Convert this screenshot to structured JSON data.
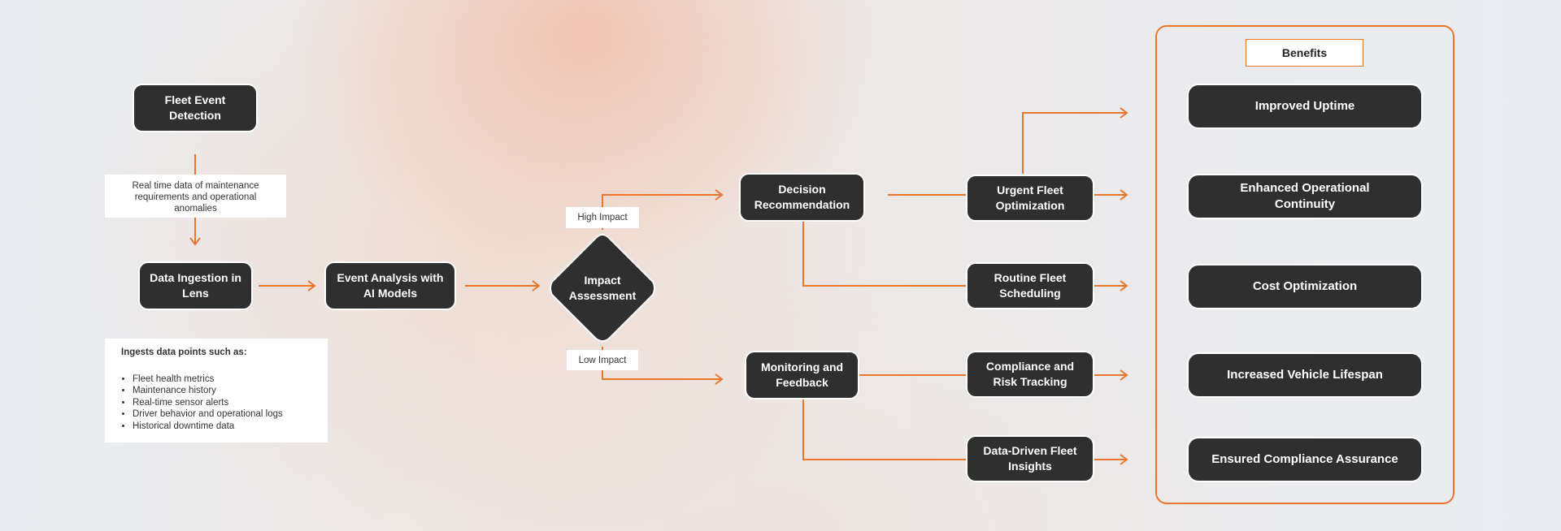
{
  "colors": {
    "accent": "#e8762d",
    "node_fill": "#2f2f2f",
    "node_text": "#ffffff"
  },
  "nodes": {
    "fleet_event_detection": "Fleet Event Detection",
    "data_ingestion": "Data Ingestion in Lens",
    "event_analysis": "Event Analysis with AI Models",
    "impact_assessment": "Impact Assessment",
    "decision_recommendation": "Decision Recommendation",
    "monitoring_feedback": "Monitoring and Feedback",
    "urgent_fleet_optimization": "Urgent Fleet Optimization",
    "routine_fleet_scheduling": "Routine Fleet Scheduling",
    "compliance_risk_tracking": "Compliance and Risk Tracking",
    "data_driven_insights": "Data-Driven Fleet Insights"
  },
  "notes": {
    "realtime": "Real time data of maintenance requirements and operational anomalies",
    "ingests_title": "Ingests data points such as:",
    "ingests_items": [
      "Fleet health metrics",
      "Maintenance history",
      "Real-time sensor alerts",
      "Driver behavior and operational logs",
      "Historical downtime data"
    ]
  },
  "branches": {
    "high": "High Impact",
    "low": "Low Impact"
  },
  "benefits": {
    "title": "Benefits",
    "items": [
      "Improved Uptime",
      "Enhanced Operational Continuity",
      "Cost Optimization",
      "Increased Vehicle Lifespan",
      "Ensured Compliance Assurance"
    ]
  }
}
